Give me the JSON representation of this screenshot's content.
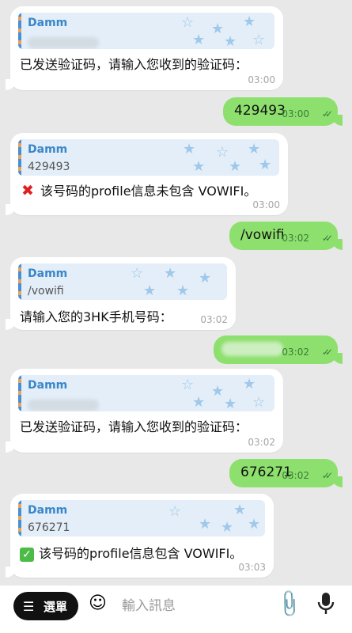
{
  "messages": [
    {
      "sender": "Damm",
      "text": "已发送验证码，请输入您收到的验证码：",
      "time": "03:00"
    },
    {
      "text": "429493",
      "time": "03:00"
    },
    {
      "sender": "Damm",
      "quote": "429493",
      "text": "该号码的profile信息未包含 VOWIFI。",
      "time": "03:00"
    },
    {
      "text": "/vowifi",
      "time": "03:02"
    },
    {
      "sender": "Damm",
      "quote": "/vowifi",
      "text": "请输入您的3HK手机号码：",
      "time": "03:02"
    },
    {
      "time": "03:02"
    },
    {
      "sender": "Damm",
      "text": "已发送验证码，请输入您收到的验证码：",
      "time": "03:02"
    },
    {
      "text": "676271",
      "time": "03:02"
    },
    {
      "sender": "Damm",
      "quote": "676271",
      "text": "该号码的profile信息包含 VOWIFI。",
      "time": "03:03"
    }
  ],
  "emoji": {
    "cross": "✖",
    "check": "✓"
  },
  "read_check": "✓✓",
  "composer": {
    "menu_label": "選單",
    "placeholder": "輸入訊息",
    "icons": [
      "menu-icon",
      "sticker-icon",
      "attach-icon",
      "microphone-icon"
    ]
  },
  "colors": {
    "outgoing": "#8ee06e",
    "incoming": "#ffffff",
    "quote_name": "#3a86c9",
    "quote_bg": "#e3eef8"
  }
}
